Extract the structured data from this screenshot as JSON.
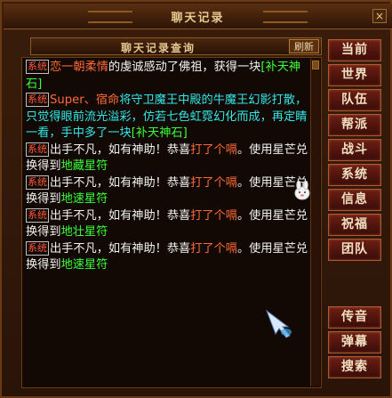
{
  "window": {
    "title": "聊天记录",
    "close_icon": "close-icon"
  },
  "log_panel": {
    "title": "聊天记录查询",
    "refresh_label": "刷新"
  },
  "messages": [
    {
      "tag": "系统",
      "parts": [
        {
          "text": "恋一朝柔情",
          "color": "red"
        },
        {
          "text": "的虔诚感动了佛祖，获得一块",
          "color": "white"
        },
        {
          "text": "[补天神石]",
          "color": "green"
        }
      ]
    },
    {
      "tag": "系统",
      "parts": [
        {
          "text": "Super、宿命",
          "color": "red"
        },
        {
          "text": "将守卫魔王中殿的牛魔王幻影打散，只觉得眼前流光溢彩，仿若七色虹霓幻化而成，再定睛一看，手中多了一块",
          "color": "cyan"
        },
        {
          "text": "[补天神石]",
          "color": "green"
        }
      ]
    },
    {
      "tag": "系统",
      "parts": [
        {
          "text": "出手不凡，如有神助！恭喜",
          "color": "white"
        },
        {
          "text": "打了个嗝",
          "color": "red"
        },
        {
          "text": "。使用星芒兑换得到",
          "color": "white"
        },
        {
          "text": "地藏星符",
          "color": "green"
        }
      ]
    },
    {
      "tag": "系统",
      "parts": [
        {
          "text": "出手不凡，如有神助！恭喜",
          "color": "white"
        },
        {
          "text": "打了个嗝",
          "color": "red"
        },
        {
          "text": "。使用星芒兑换得到",
          "color": "white"
        },
        {
          "text": "地速星符",
          "color": "green"
        }
      ]
    },
    {
      "tag": "系统",
      "parts": [
        {
          "text": "出手不凡，如有神助！恭喜",
          "color": "white"
        },
        {
          "text": "打了个嗝",
          "color": "red"
        },
        {
          "text": "。使用星芒兑换得到",
          "color": "white"
        },
        {
          "text": "地壮星符",
          "color": "green"
        }
      ]
    },
    {
      "tag": "系统",
      "parts": [
        {
          "text": "出手不凡，如有神助！恭喜",
          "color": "white"
        },
        {
          "text": "打了个嗝",
          "color": "red"
        },
        {
          "text": "。使用星芒兑换得到",
          "color": "white"
        },
        {
          "text": "地速星符",
          "color": "green"
        }
      ]
    }
  ],
  "channel_buttons": [
    "当前",
    "世界",
    "队伍",
    "帮派",
    "战斗",
    "系统",
    "信息",
    "祝福",
    "团队"
  ],
  "tool_buttons": [
    "传音",
    "弹幕",
    "搜索"
  ],
  "colors": {
    "system_tag": "#ff5a3c",
    "player_name": "#ff6a3a",
    "item_name": "#39ff3a",
    "event_text": "#33e6e6",
    "button_bg": "#6b1e14"
  }
}
